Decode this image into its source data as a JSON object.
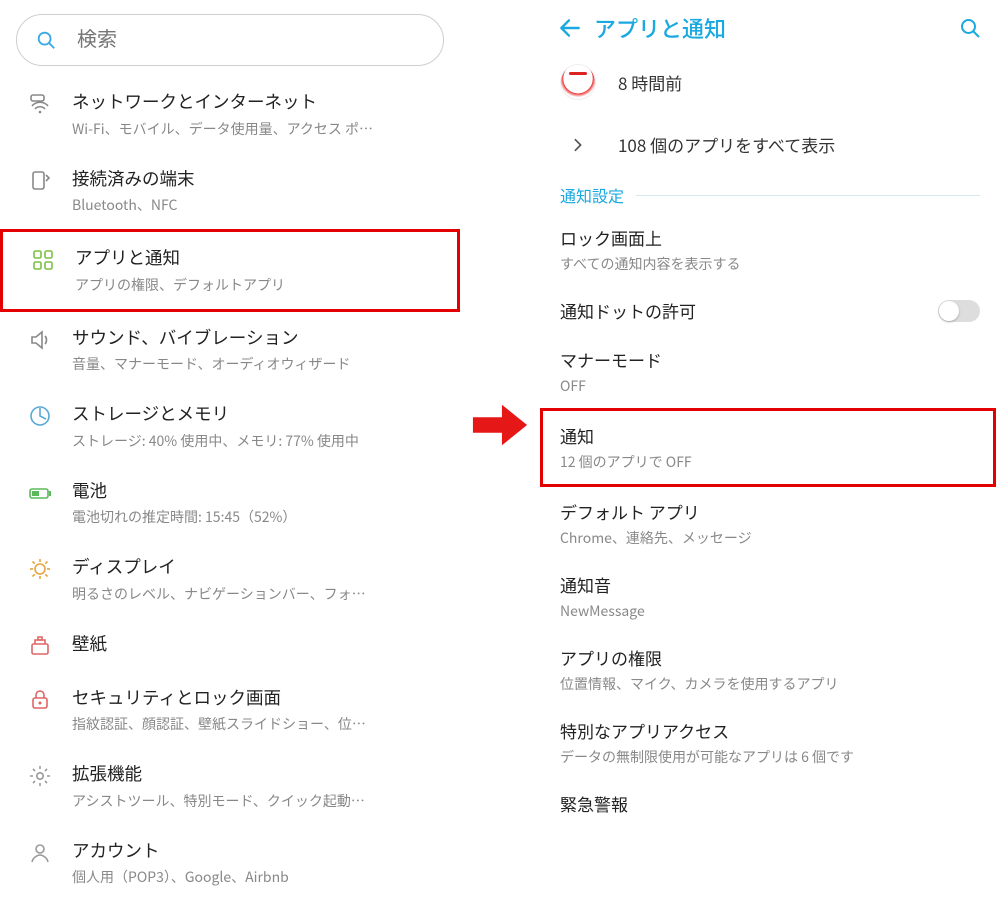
{
  "left": {
    "search_placeholder": "検索",
    "items": [
      {
        "title": "ネットワークとインターネット",
        "sub": "Wi-Fi、モバイル、データ使用量、アクセス ポ…"
      },
      {
        "title": "接続済みの端末",
        "sub": "Bluetooth、NFC"
      },
      {
        "title": "アプリと通知",
        "sub": "アプリの権限、デフォルトアプリ"
      },
      {
        "title": "サウンド、バイブレーション",
        "sub": "音量、マナーモード、オーディオウィザード"
      },
      {
        "title": "ストレージとメモリ",
        "sub": "ストレージ: 40% 使用中、メモリ: 77% 使用中"
      },
      {
        "title": "電池",
        "sub": "電池切れの推定時間: 15:45（52%）"
      },
      {
        "title": "ディスプレイ",
        "sub": "明るさのレベル、ナビゲーションバー、フォ…"
      },
      {
        "title": "壁紙",
        "sub": ""
      },
      {
        "title": "セキュリティとロック画面",
        "sub": "指紋認証、顔認証、壁紙スライドショー、位…"
      },
      {
        "title": "拡張機能",
        "sub": "アシストツール、特別モード、クイック起動…"
      },
      {
        "title": "アカウント",
        "sub": "個人用（POP3）、Google、Airbnb"
      }
    ]
  },
  "right": {
    "header_title": "アプリと通知",
    "recent_time": "8 時間前",
    "show_all": "108 個のアプリをすべて表示",
    "section_label": "通知設定",
    "rows": {
      "lock_title": "ロック画面上",
      "lock_sub": "すべての通知内容を表示する",
      "dot_title": "通知ドットの許可",
      "manner_title": "マナーモード",
      "manner_sub": "OFF",
      "notif_title": "通知",
      "notif_sub": "12 個のアプリで OFF",
      "default_title": "デフォルト アプリ",
      "default_sub": "Chrome、連絡先、メッセージ",
      "sound_title": "通知音",
      "sound_sub": "NewMessage",
      "perm_title": "アプリの権限",
      "perm_sub": "位置情報、マイク、カメラを使用するアプリ",
      "special_title": "特別なアプリアクセス",
      "special_sub": "データの無制限使用が可能なアプリは 6 個です",
      "emergency_title": "緊急警報"
    }
  }
}
